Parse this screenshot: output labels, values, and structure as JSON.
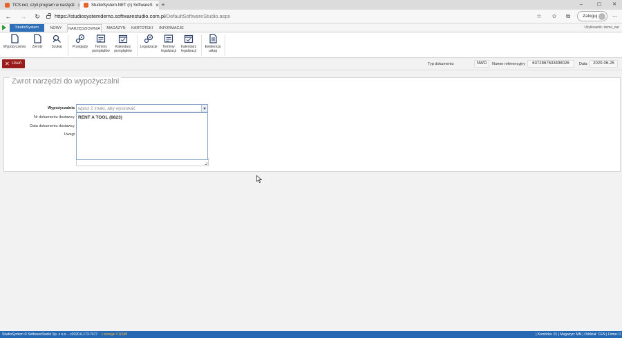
{
  "browser": {
    "tabs": [
      {
        "title": "TCS.net, czyli program w narzędz"
      },
      {
        "title": "StudioSystem.NET (c) SoftwareS"
      }
    ],
    "url_host": "https://studiosystemdemo.softwarestudio.com.pl",
    "url_path": "/DefaultSoftwareStudio.aspx",
    "login_label": "Zaloguj",
    "more_label": "···"
  },
  "app": {
    "brand_button": "StudioSystem",
    "menu_tabs": [
      "NOWY",
      "NARZĘDZIOWNIA",
      "MAGAZYN",
      "KARTOTEKI",
      "INFORMACJE"
    ],
    "active_menu_tab": "NARZĘDZIOWNIA",
    "user_label": "Użytkownik: demo_nar"
  },
  "ribbon": {
    "items": [
      {
        "label": "Wypożyczenia",
        "icon": "document-icon"
      },
      {
        "label": "Zwroty",
        "icon": "document-icon"
      },
      {
        "label": "Szukaj",
        "icon": "search-tools-icon"
      },
      {
        "label": "Przeglądy",
        "icon": "gears-icon"
      },
      {
        "label": "Terminy przeglądów",
        "icon": "list-calendar-icon"
      },
      {
        "label": "Kalendarz przeglądów",
        "icon": "calendar-icon"
      },
      {
        "label": "Legalizacje",
        "icon": "gears-icon"
      },
      {
        "label": "Terminy legalizacji",
        "icon": "list-calendar-icon"
      },
      {
        "label": "Kalendarz legalizacji",
        "icon": "calendar-icon"
      },
      {
        "label": "Ewidencja usług",
        "icon": "document-list-icon"
      }
    ]
  },
  "toolbar": {
    "delete_label": "Usuń",
    "doc_type_label": "Typ dokumentu",
    "doc_type_value": "NWD",
    "ref_label": "Numer referencyjny",
    "ref_value": "6372867633498026",
    "date_label": "Data",
    "date_value": "2020-06-25"
  },
  "form": {
    "title": "Zwrot narzędzi do wypożyczalni",
    "fields": {
      "rental_label": "Wypożyczalnia",
      "rental_placeholder": "wpisz 2 znaki, aby wyszukać",
      "delivery_no_label": "Nr dokumentu dostawcy",
      "delivery_date_label": "Data dokumentu dostawcy",
      "notes_label": "Uwagi"
    },
    "dropdown_options": [
      "RENT A TOOL (8823)"
    ]
  },
  "statusbar": {
    "left": "StudioSystem © SoftwareStudio Sp. z o.o. - v2020.6.173.7477",
    "license": "Licencja: CUSM!",
    "right": "| Komórka: 01 | Magazyn: MN | Oddział: CEN | Firma: 0"
  },
  "colors": {
    "brand_blue": "#2f6fb7",
    "delete_red": "#9b1b1b",
    "status_blue": "#2569b3",
    "license_yellow": "#ffc23a"
  }
}
